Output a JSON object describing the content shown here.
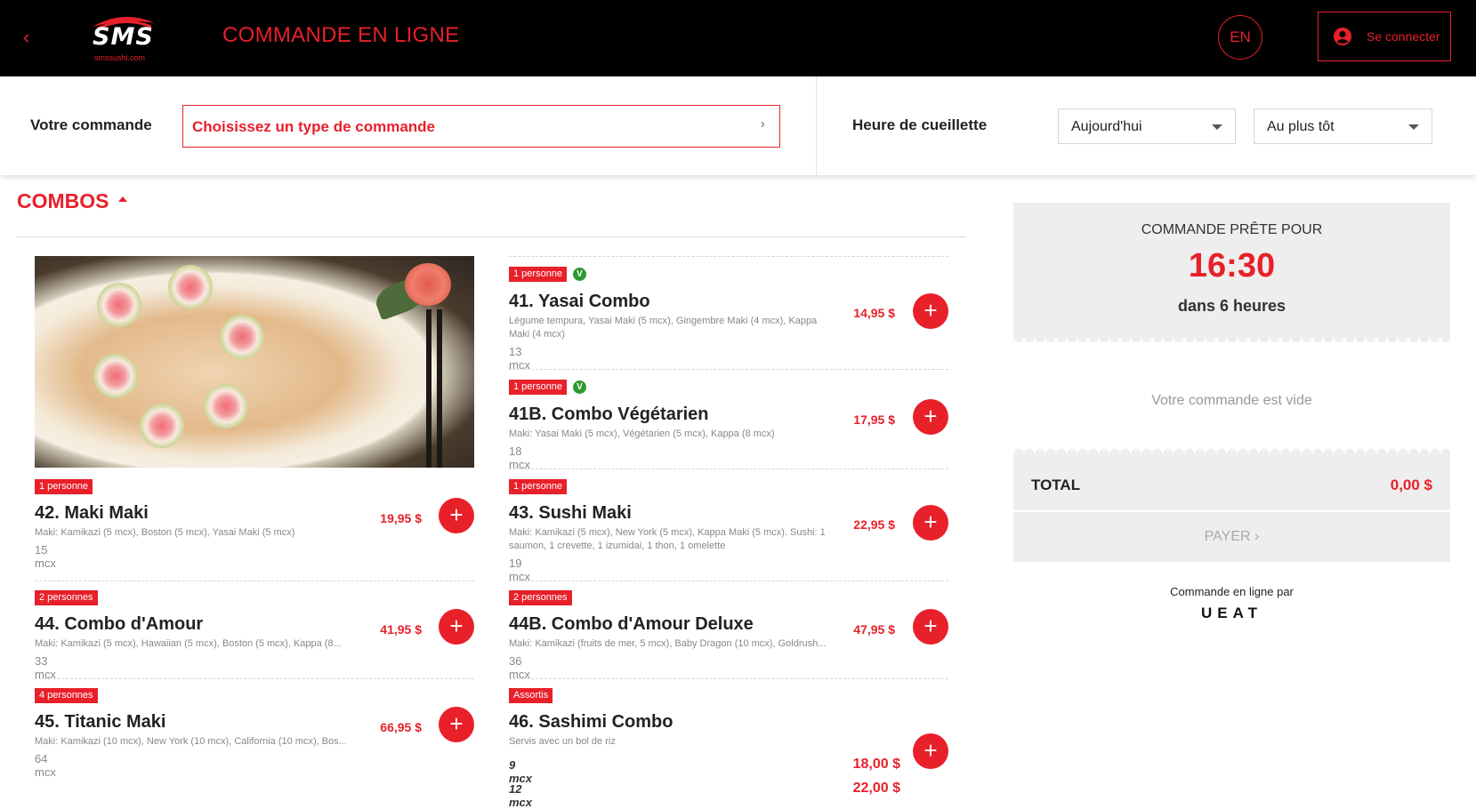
{
  "header": {
    "back_icon": "‹",
    "logo_text": "SMS",
    "logo_sub": "smssushi.com",
    "title": "COMMANDE EN LIGNE",
    "lang": "EN",
    "login_label": "Se connecter",
    "accent_color": "#e8202a"
  },
  "orderbar": {
    "order_label": "Votre commande",
    "order_type_placeholder": "Choisissez un type de commande",
    "pickup_label": "Heure de cueillette",
    "day_value": "Aujourd'hui",
    "time_value": "Au plus tôt"
  },
  "section": {
    "title": "COMBOS"
  },
  "items": [
    {
      "badge": "1 personne",
      "veg": false,
      "name": "42. Maki Maki",
      "desc": "Maki: Kamikazi (5 mcx), Boston (5 mcx), Yasai Maki (5 mcx)",
      "count": "15 mcx",
      "price": "19,95 $"
    },
    {
      "badge": "2 personnes",
      "veg": false,
      "name": "44. Combo d'Amour",
      "desc": "Maki: Kamikazi (5 mcx), Hawaiian (5 mcx), Boston (5 mcx), Kappa (8...",
      "count": "33 mcx",
      "price": "41,95 $"
    },
    {
      "badge": "4 personnes",
      "veg": false,
      "name": "45. Titanic Maki",
      "desc": "Maki: Kamikazi (10 mcx), New York (10 mcx), California (10 mcx), Bos...",
      "count": "64 mcx",
      "price": "66,95 $"
    },
    {
      "badge": "1 personne",
      "veg": true,
      "name": "41. Yasai Combo",
      "desc": "Légume tempura, Yasai Maki (5 mcx), Gingembre Maki (4 mcx), Kappa Maki (4 mcx)",
      "count": "13 mcx",
      "price": "14,95 $"
    },
    {
      "badge": "1 personne",
      "veg": true,
      "name": "41B. Combo Végétarien",
      "desc": "Maki: Yasai Maki (5 mcx), Végétarien (5 mcx), Kappa (8 mcx)",
      "count": "18 mcx",
      "price": "17,95 $"
    },
    {
      "badge": "1 personne",
      "veg": false,
      "name": "43. Sushi Maki",
      "desc": "Maki: Kamikazi (5 mcx), New York (5 mcx), Kappa Maki (5 mcx). Sushi: 1 saumon, 1 crevette, 1 izumidai, 1 thon, 1 omelette",
      "count": "19 mcx",
      "price": "22,95 $"
    },
    {
      "badge": "2 personnes",
      "veg": false,
      "name": "44B. Combo d'Amour Deluxe",
      "desc": "Maki: Kamikazi (fruits de mer, 5 mcx), Baby Dragon (10 mcx), Goldrush...",
      "count": "36 mcx",
      "price": "47,95 $"
    },
    {
      "badge": "Assortis",
      "veg": false,
      "name": "46. Sashimi Combo",
      "desc": "Servis avec un bol de riz",
      "variants": [
        {
          "label": "9 mcx",
          "price": "18,00 $"
        },
        {
          "label": "12 mcx",
          "price": "22,00 $"
        }
      ]
    }
  ],
  "veg_icon": "V",
  "add_icon": "+",
  "cart": {
    "ready_label": "COMMANDE PRÊTE POUR",
    "ready_time": "16:30",
    "ready_eta": "dans 6 heures",
    "empty": "Votre commande est vide",
    "total_label": "TOTAL",
    "total_value": "0,00 $",
    "pay_label": "PAYER ›",
    "powered_by": "Commande en ligne par",
    "brand": "UEAT"
  }
}
